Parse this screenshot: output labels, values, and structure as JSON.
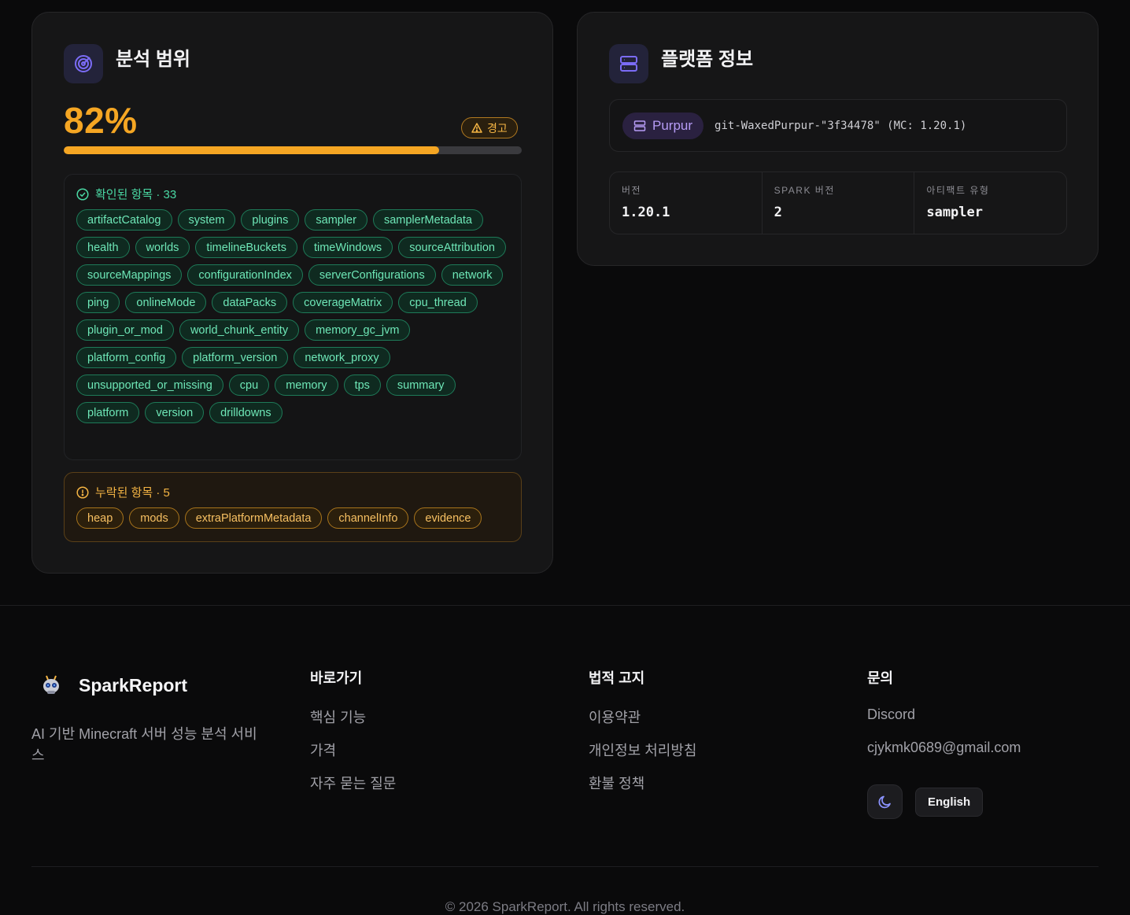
{
  "coverage": {
    "title": "분석 범위",
    "percent_text": "82%",
    "percent": 82,
    "warning_label": "경고",
    "confirmed": {
      "label": "확인된 항목 · 33",
      "items": [
        "artifactCatalog",
        "system",
        "plugins",
        "sampler",
        "samplerMetadata",
        "health",
        "worlds",
        "timelineBuckets",
        "timeWindows",
        "sourceAttribution",
        "sourceMappings",
        "configurationIndex",
        "serverConfigurations",
        "network",
        "ping",
        "onlineMode",
        "dataPacks",
        "coverageMatrix",
        "cpu_thread",
        "plugin_or_mod",
        "world_chunk_entity",
        "memory_gc_jvm",
        "platform_config",
        "platform_version",
        "network_proxy",
        "unsupported_or_missing",
        "cpu",
        "memory",
        "tps",
        "summary",
        "platform",
        "version",
        "drilldowns"
      ]
    },
    "missing": {
      "label": "누락된 항목 · 5",
      "items": [
        "heap",
        "mods",
        "extraPlatformMetadata",
        "channelInfo",
        "evidence"
      ]
    },
    "icon": "radar-target-icon",
    "colors": {
      "accent": "#f5a623",
      "ok": "#6ee7b7",
      "warn": "#f7c062"
    }
  },
  "platform": {
    "title": "플랫폼 정보",
    "icon": "server-icon",
    "name": "Purpur",
    "build": "git-WaxedPurpur-\"3f34478\" (MC: 1.20.1)",
    "stats": [
      {
        "label": "버전",
        "value": "1.20.1"
      },
      {
        "label": "SPARK 버전",
        "value": "2"
      },
      {
        "label": "아티팩트 유형",
        "value": "sampler"
      }
    ]
  },
  "footer": {
    "brand": "SparkReport",
    "tagline": "AI 기반 Minecraft 서버 성능 분석 서비스",
    "nav": {
      "title": "바로가기",
      "links": [
        "핵심 기능",
        "가격",
        "자주 묻는 질문"
      ]
    },
    "legal": {
      "title": "법적 고지",
      "links": [
        "이용약관",
        "개인정보 처리방침",
        "환불 정책"
      ]
    },
    "contact": {
      "title": "문의",
      "links": [
        "Discord",
        "cjykmk0689@gmail.com"
      ]
    },
    "theme_icon": "moon-icon",
    "language_button": "English",
    "copyright": "© 2026 SparkReport. All rights reserved."
  }
}
